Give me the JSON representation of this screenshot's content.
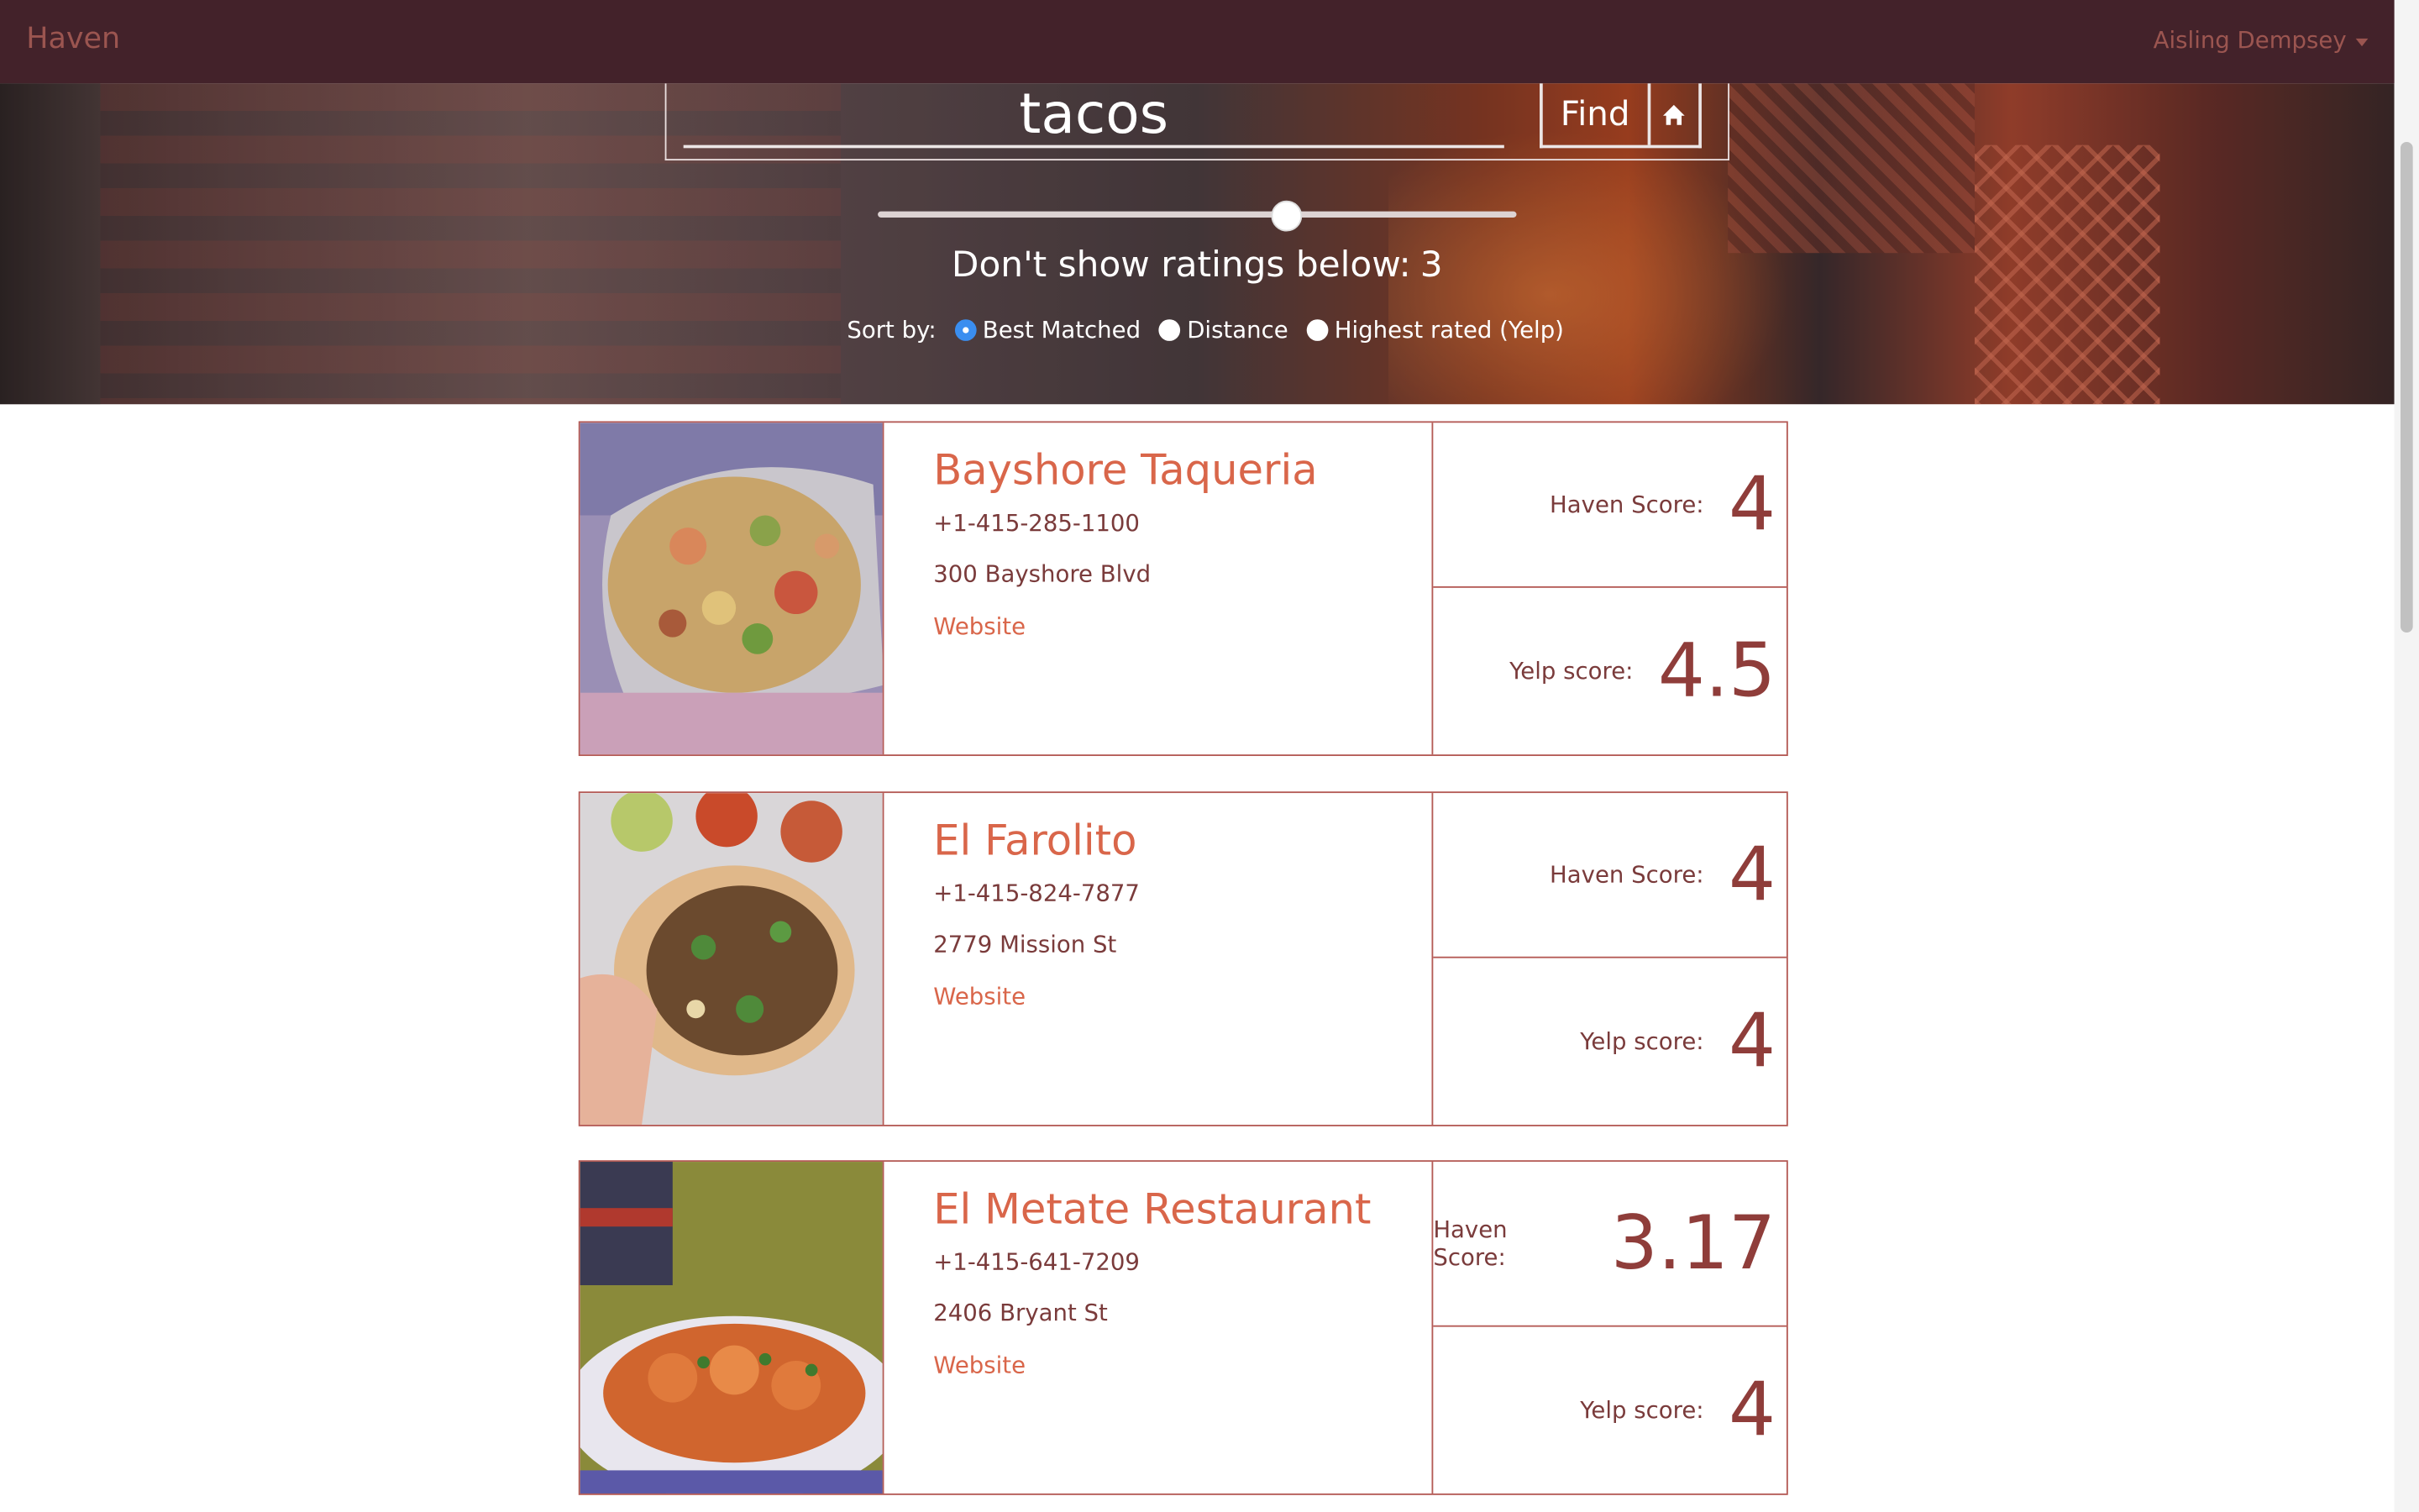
{
  "navbar": {
    "brand": "Haven",
    "user_name": "Aisling Dempsey"
  },
  "search": {
    "query": "tacos",
    "find_label": "Find",
    "home_icon": "home-icon"
  },
  "filter": {
    "rating_label": "Don't show ratings below:",
    "rating_value": "3",
    "slider_value": 3,
    "slider_max": 5
  },
  "sort": {
    "label": "Sort by:",
    "options": [
      {
        "label": "Best Matched",
        "checked": true
      },
      {
        "label": "Distance",
        "checked": false
      },
      {
        "label": "Highest rated (Yelp)",
        "checked": false
      }
    ]
  },
  "results": [
    {
      "name": "Bayshore Taqueria",
      "phone": "+1-415-285-1100",
      "address": "300 Bayshore Blvd",
      "website_label": "Website",
      "haven_label": "Haven Score:",
      "haven_score": "4",
      "yelp_label": "Yelp score:",
      "yelp_score": "4.5"
    },
    {
      "name": "El Farolito",
      "phone": "+1-415-824-7877",
      "address": "2779 Mission St",
      "website_label": "Website",
      "haven_label": "Haven Score:",
      "haven_score": "4",
      "yelp_label": "Yelp score:",
      "yelp_score": "4"
    },
    {
      "name": "El Metate Restaurant",
      "phone": "+1-415-641-7209",
      "address": "2406 Bryant St",
      "website_label": "Website",
      "haven_label": "Haven Score:",
      "haven_score": "3.17",
      "yelp_label": "Yelp score:",
      "yelp_score": "4"
    }
  ],
  "colors": {
    "navbar_bg": "#43222a",
    "brand": "#9b5550",
    "accent": "#d9664a",
    "card_border": "#b45a55",
    "score": "#8f3d3a",
    "radio_checked": "#3a8ef0"
  }
}
